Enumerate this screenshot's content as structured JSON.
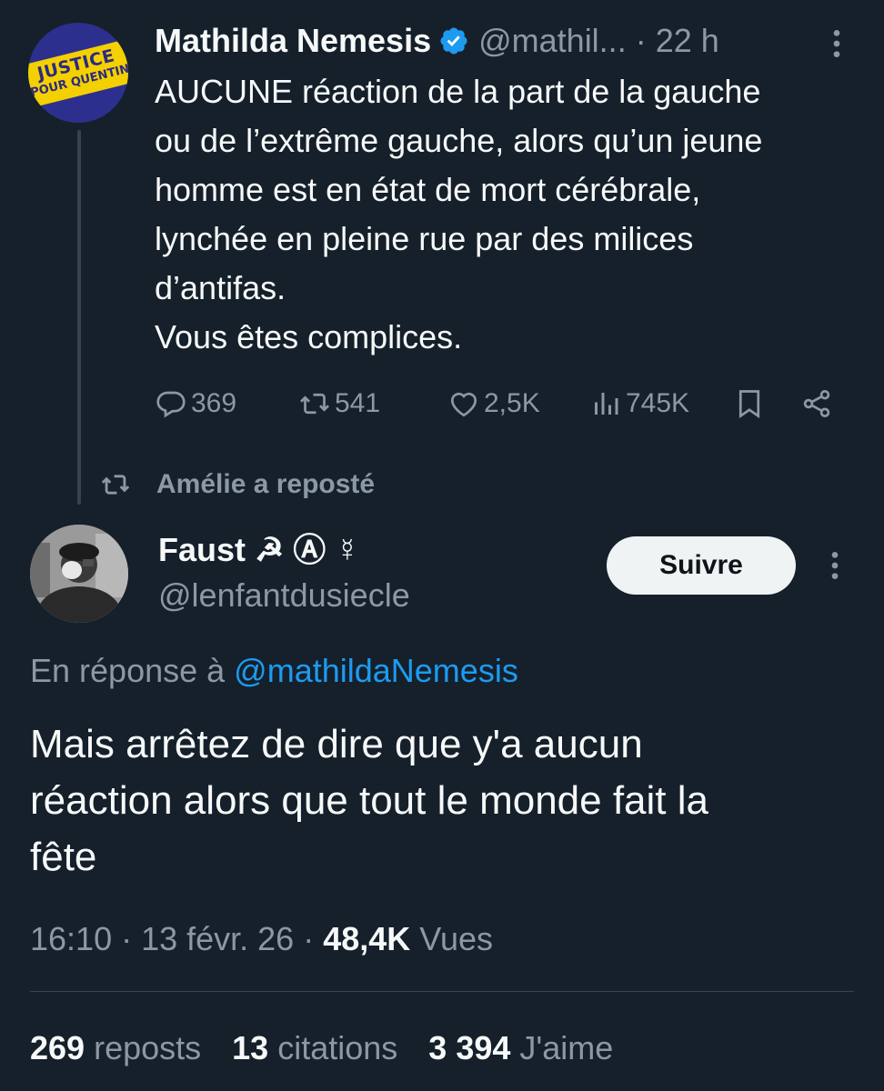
{
  "tweet1": {
    "avatar_text": [
      "JUSTICE",
      "POUR QUENTIN"
    ],
    "name": "Mathilda Nemesis",
    "handle": "@mathil...",
    "time": "· 22 h",
    "lines": [
      "AUCUNE réaction de la part de la gauche",
      "ou de l’extrême gauche, alors qu’un jeune",
      "homme est en état de mort cérébrale,",
      "lynchée en pleine rue par des milices",
      "d’antifas.",
      "Vous êtes complices."
    ],
    "actions": {
      "replies": "369",
      "reposts": "541",
      "likes": "2,5K",
      "views": "745K"
    },
    "icons": [
      "verified-icon",
      "more-icon",
      "reply-icon",
      "repost-icon",
      "like-icon",
      "views-icon",
      "bookmark-icon",
      "share-icon"
    ]
  },
  "repost_line": "Amélie a reposté",
  "tweet2": {
    "name": "Faust ☭ Ⓐ ☿",
    "handle": "@lenfantdusiecle",
    "follow_label": "Suivre",
    "reply_prefix": "En réponse à",
    "reply_handle": "@mathildaNemesis",
    "lines": [
      "Mais arrêtez de dire que y'a aucun",
      "réaction alors que tout le monde fait la",
      "fête"
    ],
    "meta": {
      "time": "16:10 · 13 févr. 26 ·",
      "views_count": "48,4K",
      "views_label": "Vues"
    },
    "stats": {
      "reposts_count": "269",
      "reposts_label": "reposts",
      "quotes_count": "13",
      "quotes_label": "citations",
      "likes_count": "3 394",
      "likes_label": "J'aime"
    }
  },
  "colors": {
    "background": "#15202b",
    "text": "#f7f9f9",
    "muted": "#8b98a5",
    "accent": "#1d9bf0"
  }
}
